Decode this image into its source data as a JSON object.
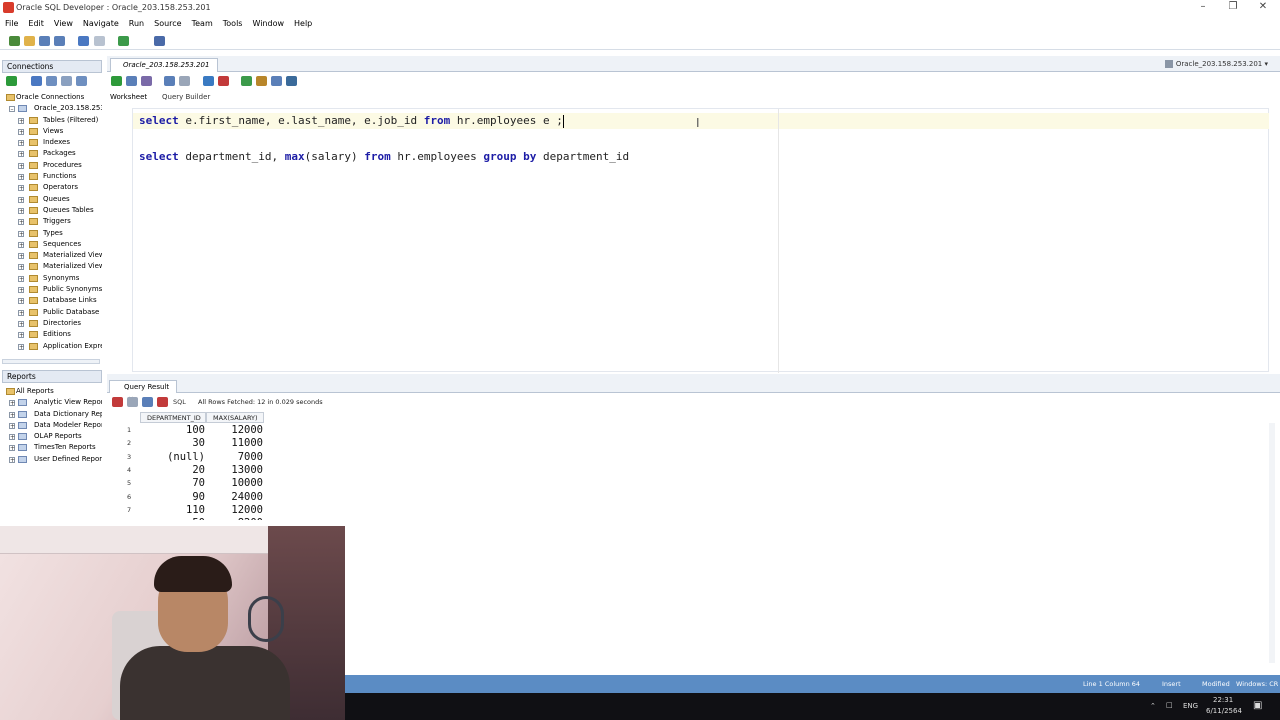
{
  "window": {
    "title": "Oracle SQL Developer : Oracle_203.158.253.201"
  },
  "menu": [
    "File",
    "Edit",
    "View",
    "Navigate",
    "Run",
    "Source",
    "Team",
    "Tools",
    "Window",
    "Help"
  ],
  "connections_panel": {
    "title": "Connections",
    "root": "Oracle Connections",
    "connection": "Oracle_203.158.253.201",
    "items": [
      "Tables (Filtered)",
      "Views",
      "Indexes",
      "Packages",
      "Procedures",
      "Functions",
      "Operators",
      "Queues",
      "Queues Tables",
      "Triggers",
      "Types",
      "Sequences",
      "Materialized View",
      "Materialized View",
      "Synonyms",
      "Public Synonyms",
      "Database Links",
      "Public Database",
      "Directories",
      "Editions",
      "Application Expre"
    ]
  },
  "reports_panel": {
    "title": "Reports",
    "items": [
      "All Reports",
      "Analytic View Reports",
      "Data Dictionary Reports",
      "Data Modeler Reports",
      "OLAP Reports",
      "TimesTen Reports",
      "User Defined Reports"
    ]
  },
  "editor": {
    "tab_label": "Oracle_203.158.253.201",
    "connection_selector": "Oracle_203.158.253.201",
    "subtabs": [
      "Worksheet",
      "Query Builder"
    ],
    "line1": {
      "kw1": "select",
      "t1": " e.first_name, e.last_name, e.job_id ",
      "kw2": "from",
      "t2": " hr.employees e ;"
    },
    "line2": {
      "kw1": "select",
      "t1": " department_id, ",
      "kw2": "max",
      "t2": "(salary) ",
      "kw3": "from",
      "t3": " hr.employees ",
      "kw4": "group by",
      "t4": " department_id"
    }
  },
  "results": {
    "tab_label": "Query Result",
    "sql_label": "SQL",
    "fetched": "All Rows Fetched: 12 in 0.029 seconds",
    "columns": [
      "DEPARTMENT_ID",
      "MAX(SALARY)"
    ],
    "rows": [
      {
        "n": "1",
        "d": "100",
        "s": "12000"
      },
      {
        "n": "2",
        "d": "30",
        "s": "11000"
      },
      {
        "n": "3",
        "d": "(null)",
        "s": "7000"
      },
      {
        "n": "4",
        "d": "20",
        "s": "13000"
      },
      {
        "n": "5",
        "d": "70",
        "s": "10000"
      },
      {
        "n": "6",
        "d": "90",
        "s": "24000"
      },
      {
        "n": "7",
        "d": "110",
        "s": "12000"
      },
      {
        "n": "8",
        "d": "50",
        "s": "8200"
      }
    ]
  },
  "statusbar": {
    "position": "Line 1 Column 64",
    "mode": "Insert",
    "modified": "Modified",
    "os": "Windows: CR"
  },
  "taskbar": {
    "lang": "ENG",
    "time": "22:31",
    "date": "6/11/2564"
  }
}
